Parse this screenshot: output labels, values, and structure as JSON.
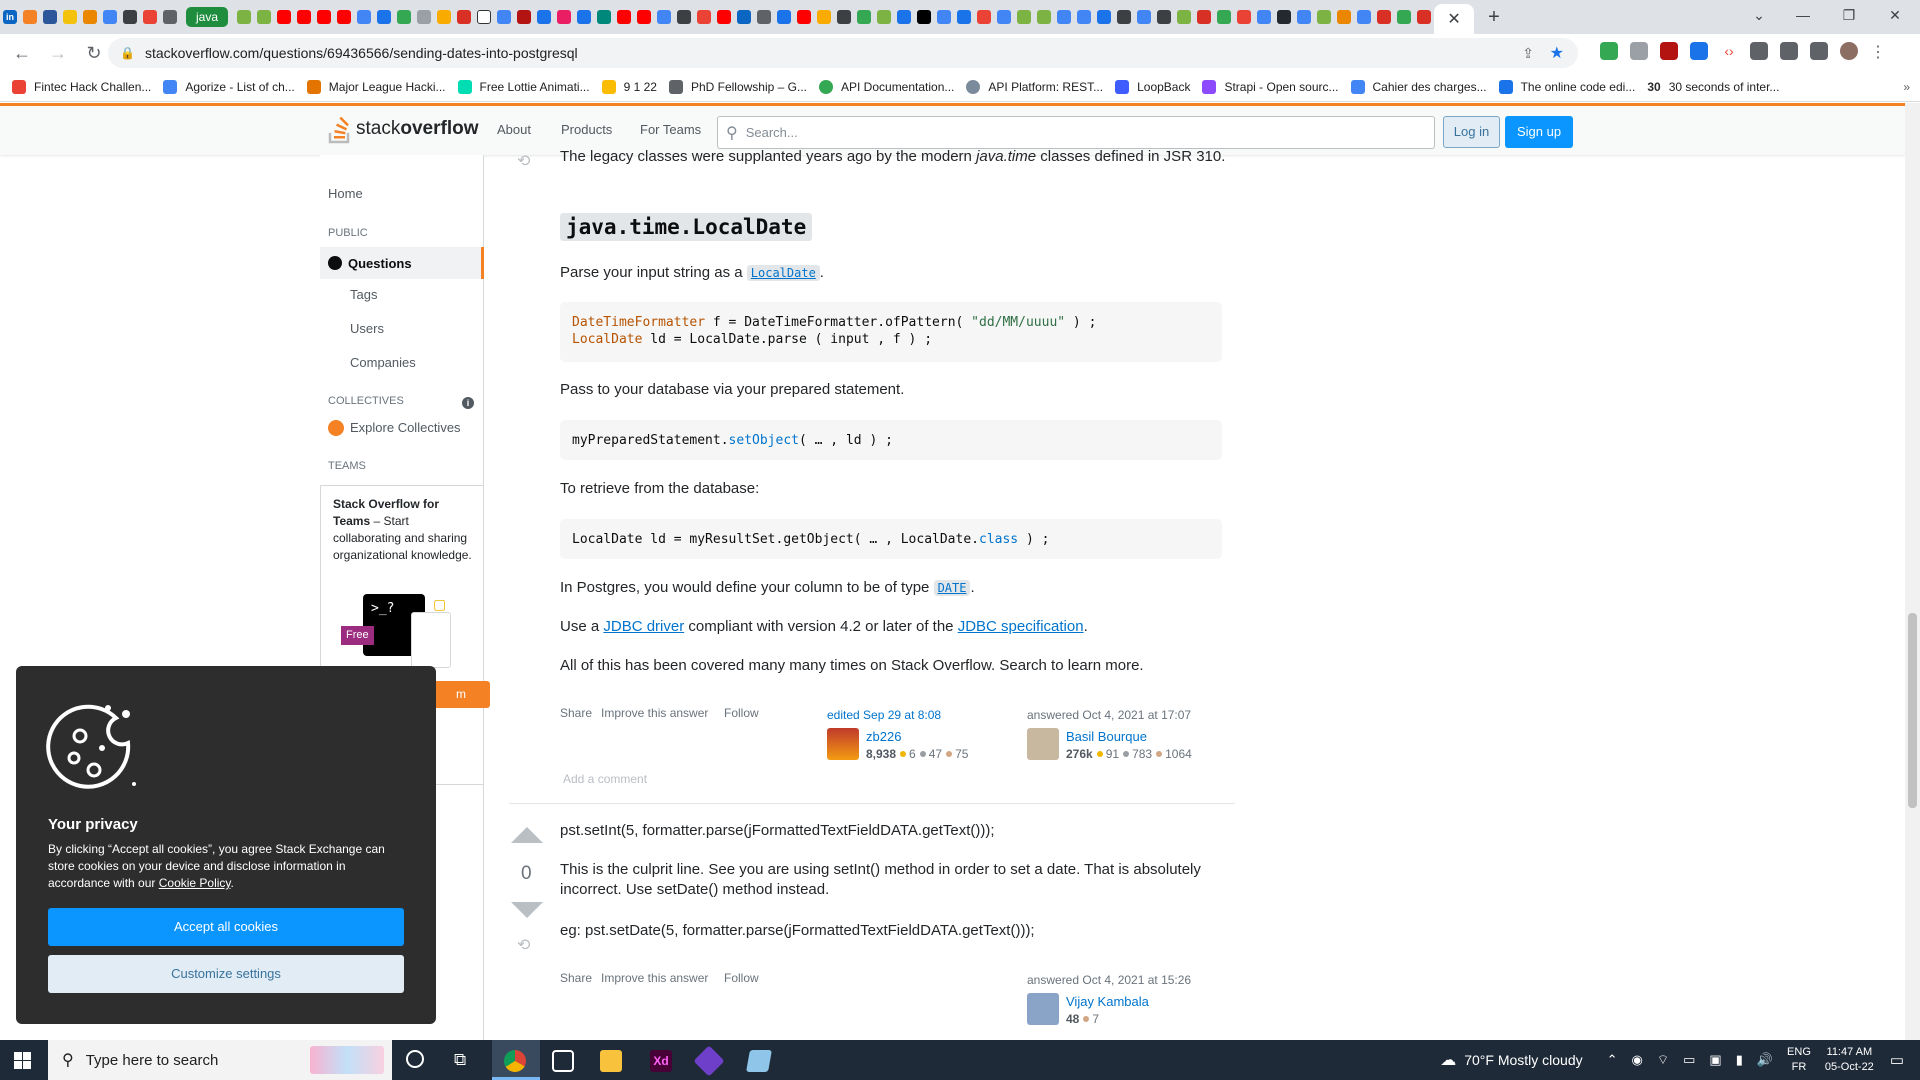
{
  "browser": {
    "pinned_tab": "java",
    "url": "stackoverflow.com/questions/69436566/sending-dates-into-postgresql",
    "bookmarks": [
      {
        "label": "Fintec Hack Challen...",
        "color": "#ea4335"
      },
      {
        "label": "Agorize - List of ch...",
        "color": "#4285f4"
      },
      {
        "label": "Major League Hacki...",
        "color": "#e37400"
      },
      {
        "label": "Free Lottie Animati...",
        "color": "#00ddb3"
      },
      {
        "label": "9 1 22",
        "color": "#fbbc04"
      },
      {
        "label": "PhD Fellowship – G...",
        "color": "#5f6368"
      },
      {
        "label": "API Documentation...",
        "color": "#34a853"
      },
      {
        "label": "API Platform: REST...",
        "color": "#7c8b9b"
      },
      {
        "label": "LoopBack",
        "color": "#3f5dff"
      },
      {
        "label": "Strapi - Open sourc...",
        "color": "#8c4bff"
      },
      {
        "label": "Cahier des charges...",
        "color": "#4285f4"
      },
      {
        "label": "The online code edi...",
        "color": "#1a73e8"
      },
      {
        "label": "30 seconds of inter...",
        "color": "#2b2b2b"
      }
    ],
    "bookmark_prefix_30": "30"
  },
  "so": {
    "logo_prefix": "stack",
    "logo_suffix": "overflow",
    "nav": [
      "About",
      "Products",
      "For Teams"
    ],
    "search_placeholder": "Search...",
    "login": "Log in",
    "signup": "Sign up"
  },
  "sidebar": {
    "home": "Home",
    "public_heading": "PUBLIC",
    "questions": "Questions",
    "tags": "Tags",
    "users": "Users",
    "companies": "Companies",
    "collectives_heading": "COLLECTIVES",
    "explore_collectives": "Explore Collectives",
    "teams_heading": "TEAMS",
    "teams_title": "Stack Overflow for Teams",
    "teams_body": " – Start collaborating and sharing organizational knowledge.",
    "free_badge": "Free",
    "create_btn_fragment": "m"
  },
  "answer1": {
    "intro_prefix": "The legacy classes were supplanted years ago by the modern ",
    "intro_em": "java.time",
    "intro_suffix": " classes defined in JSR 310.",
    "heading": "java.time.LocalDate",
    "parse_prefix": "Parse your input string as a ",
    "parse_code": "LocalDate",
    "parse_suffix": ".",
    "code1_line1": {
      "t1": "DateTimeFormatter",
      "t2": " f = DateTimeFormatter.ofPattern( ",
      "t3": "\"dd/MM/uuuu\"",
      "t4": " ) ;"
    },
    "code1_line2": {
      "t1": "LocalDate",
      "t2": " ld = LocalDate.parse ( input , f ) ;"
    },
    "pass_text": "Pass to your database via your prepared statement.",
    "code2": {
      "t1": "myPreparedStatement.",
      "t2": "setObject",
      "t3": "( … , ld ) ;"
    },
    "retrieve_text": "To retrieve from the database:",
    "code3": {
      "t1": "LocalDate ld = myResultSet.getObject( … , LocalDate.",
      "t2": "class",
      "t3": " ) ;"
    },
    "postgres_prefix": "In Postgres, you would define your column to be of type ",
    "postgres_code": "DATE",
    "postgres_suffix": ".",
    "jdbc_prefix": "Use a ",
    "jdbc_link1": "JDBC driver",
    "jdbc_mid": " compliant with version 4.2 or later of the ",
    "jdbc_link2": "JDBC specification",
    "jdbc_suffix": ".",
    "covered_text": "All of this has been covered many many times on Stack Overflow. Search to learn more.",
    "actions": [
      "Share",
      "Improve this answer",
      "Follow"
    ],
    "edited": "edited Sep 29 at 8:08",
    "editor": {
      "name": "zb226",
      "rep": "8,938",
      "gold": "6",
      "silver": "47",
      "bronze": "75"
    },
    "answered": "answered Oct 4, 2021 at 17:07",
    "author": {
      "name": "Basil Bourque",
      "rep": "276k",
      "gold": "91",
      "silver": "783",
      "bronze": "1064"
    },
    "add_comment": "Add a comment"
  },
  "answer2": {
    "vote_count": "0",
    "line1": "pst.setInt(5, formatter.parse(jFormattedTextFieldDATA.getText()));",
    "line2": "This is the culprit line. See you are using setInt() method in order to set a date. That is absolutely incorrect. Use setDate() method instead.",
    "line3": "eg: pst.setDate(5, formatter.parse(jFormattedTextFieldDATA.getText()));",
    "actions": [
      "Share",
      "Improve this answer",
      "Follow"
    ],
    "answered": "answered Oct 4, 2021 at 15:26",
    "author": {
      "name": "Vijay Kambala",
      "rep": "48",
      "bronze": "7"
    }
  },
  "cookie": {
    "title": "Your privacy",
    "body_prefix": "By clicking “Accept all cookies”, you agree Stack Exchange can store cookies on your device and disclose information in accordance with our ",
    "policy_link": "Cookie Policy",
    "body_suffix": ".",
    "accept": "Accept all cookies",
    "customize": "Customize settings"
  },
  "taskbar": {
    "search_placeholder": "Type here to search",
    "weather": "70°F  Mostly cloudy",
    "lang1": "ENG",
    "lang2": "FR",
    "time": "11:47 AM",
    "date": "05-Oct-22"
  },
  "colors": {
    "accent": "#f48225",
    "link": "#0074cc",
    "primary_btn": "#0a95ff",
    "gold": "#f1b600",
    "silver": "#9a9ea3",
    "bronze": "#d1a684"
  }
}
